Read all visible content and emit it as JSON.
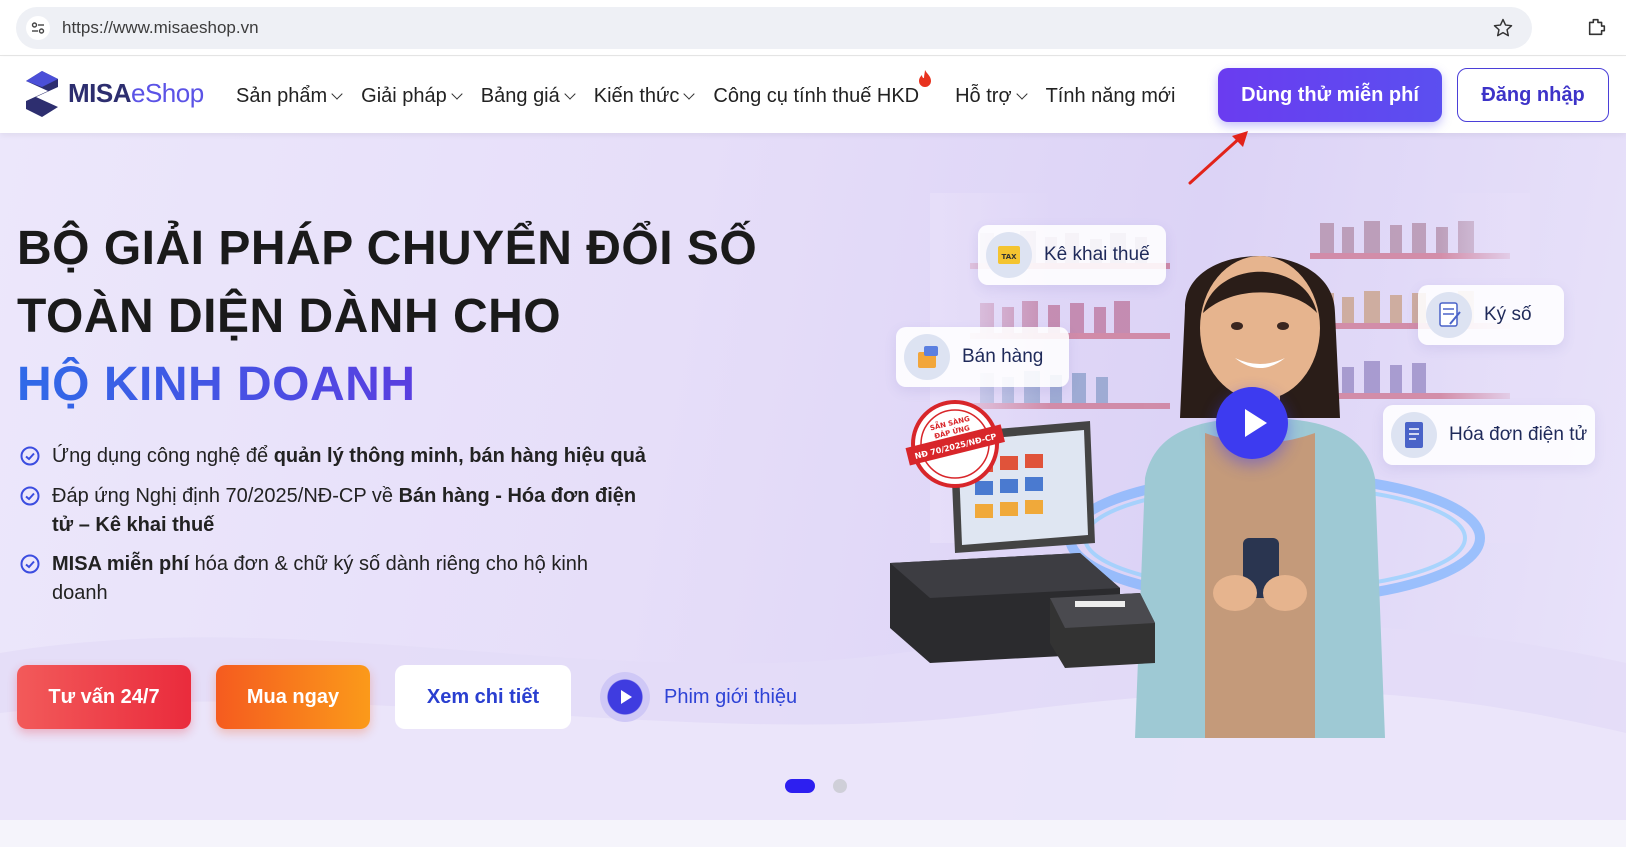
{
  "browser": {
    "url": "https://www.misaeshop.vn"
  },
  "header": {
    "logo_brand": "MISA",
    "logo_product": "eShop",
    "nav": [
      {
        "label": "Sản phẩm",
        "dropdown": true
      },
      {
        "label": "Giải pháp",
        "dropdown": true
      },
      {
        "label": "Bảng giá",
        "dropdown": true
      },
      {
        "label": "Kiến thức",
        "dropdown": true
      },
      {
        "label": "Công cụ tính thuế HKD",
        "dropdown": false
      },
      {
        "label": "Hỗ trợ",
        "dropdown": true
      },
      {
        "label": "Tính năng mới",
        "dropdown": false
      }
    ],
    "trial_button": "Dùng thử miễn phí",
    "login_button": "Đăng nhập",
    "accent": "#5b4ff0"
  },
  "hero": {
    "title_line1": "BỘ GIẢI PHÁP CHUYỂN ĐỔI SỐ",
    "title_line2": "TOÀN DIỆN DÀNH CHO",
    "title_highlight": "HỘ KINH DOANH",
    "bullets": [
      {
        "plain": "Ứng dụng công nghệ để ",
        "bold": "quản lý thông minh, bán hàng hiệu quả",
        "tail": ""
      },
      {
        "plain": "Đáp ứng Nghị định 70/2025/NĐ-CP về ",
        "bold": "Bán hàng - Hóa đơn điện tử – Kê khai thuế",
        "tail": ""
      },
      {
        "plain": "",
        "bold": "MISA miễn phí",
        "tail": " hóa đơn & chữ ký số dành riêng cho hộ kinh doanh"
      }
    ],
    "buttons": {
      "consult": "Tư vấn 24/7",
      "buy": "Mua ngay",
      "detail": "Xem chi tiết",
      "video": "Phim giới thiệu"
    },
    "feature_cards": {
      "tax": "Kê khai thuế",
      "sale": "Bán hàng",
      "sign": "Ký số",
      "invoice": "Hóa đơn điện tử"
    },
    "stamp_text": "SẴN SÀNG ĐÁP ỨNG NĐ 70/2025/NĐ-CP",
    "carousel": {
      "total": 2,
      "active": 1
    }
  }
}
